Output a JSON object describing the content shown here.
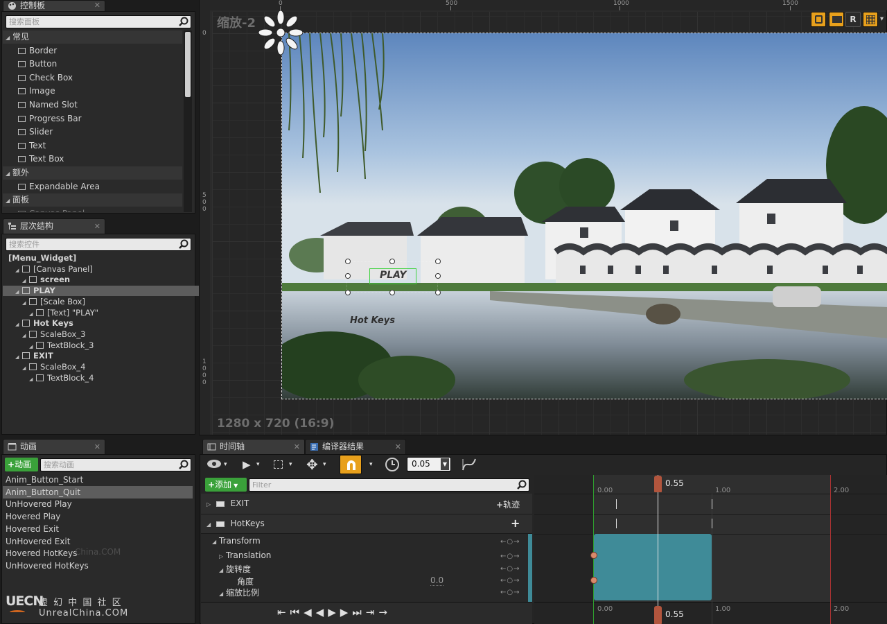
{
  "palette": {
    "title": "控制板",
    "search_placeholder": "搜索面板",
    "categories": [
      {
        "label": "常见"
      },
      {
        "label": "额外"
      },
      {
        "label": "面板"
      }
    ],
    "common_items": [
      "Border",
      "Button",
      "Check Box",
      "Image",
      "Named Slot",
      "Progress Bar",
      "Slider",
      "Text",
      "Text Box"
    ],
    "extra_items": [
      "Expandable Area"
    ],
    "panel_items": [
      "Canvas Panel"
    ]
  },
  "hierarchy": {
    "title": "层次结构",
    "search_placeholder": "搜索控件",
    "items": [
      {
        "label": "[Menu_Widget]",
        "indent": 0,
        "bold": true,
        "eye": false
      },
      {
        "label": "[Canvas Panel]",
        "indent": 1,
        "bold": false,
        "eye": true
      },
      {
        "label": "screen",
        "indent": 2,
        "bold": true,
        "eye": true
      },
      {
        "label": "PLAY",
        "indent": 1,
        "bold": true,
        "eye": true,
        "selected": true
      },
      {
        "label": "[Scale Box]",
        "indent": 2,
        "bold": false,
        "eye": true
      },
      {
        "label": "[Text] \"PLAY\"",
        "indent": 3,
        "bold": false,
        "eye": true
      },
      {
        "label": "Hot Keys",
        "indent": 1,
        "bold": true,
        "eye": true
      },
      {
        "label": "ScaleBox_3",
        "indent": 2,
        "bold": false,
        "eye": true
      },
      {
        "label": "TextBlock_3",
        "indent": 3,
        "bold": false,
        "eye": true
      },
      {
        "label": "EXIT",
        "indent": 1,
        "bold": true,
        "eye": true
      },
      {
        "label": "ScaleBox_4",
        "indent": 2,
        "bold": false,
        "eye": true
      },
      {
        "label": "TextBlock_4",
        "indent": 3,
        "bold": false,
        "eye": true
      }
    ]
  },
  "viewport": {
    "zoom_label": "缩放-2",
    "resolution": "1280 x 720 (16:9)",
    "ruler_top": [
      "0",
      "500",
      "1000",
      "1500"
    ],
    "ruler_left_500": [
      "5",
      "0",
      "0"
    ],
    "ruler_left_1000": [
      "1",
      "0",
      "0",
      "0"
    ],
    "ruler_left_0": "0",
    "canvas_play": "PLAY",
    "canvas_hotkeys": "Hot Keys",
    "right_btn_r": "R"
  },
  "animations": {
    "title": "动画",
    "add_label": "动画",
    "search_placeholder": "搜索动画",
    "items": [
      "Anim_Button_Start",
      "Anim_Button_Quit",
      "UnHovered  Play",
      "Hovered  Play",
      "Hovered  Exit",
      "UnHovered  Exit",
      "Hovered  HotKeys",
      "UnHovered HotKeys"
    ],
    "selected_index": 1
  },
  "watermark": {
    "logo": "UECN",
    "cn": "虚 幻 中 国 社 区",
    "en": "UnrealChina.COM",
    "faint": "China.COM"
  },
  "timeline": {
    "tab1": "时间轴",
    "tab2": "编译器结果",
    "step_value": "0.05",
    "add_label": "添加",
    "filter_placeholder": "Filter",
    "track_label": "轨迹",
    "tracks": [
      {
        "label": "EXIT"
      },
      {
        "label": "HotKeys"
      }
    ],
    "transform": "Transform",
    "translation": "Translation",
    "rotation": "旋转度",
    "angle": "角度",
    "angle_value": "0.0",
    "scale": "缩放比例",
    "time_labels": [
      "0.00",
      "1.00",
      "2.00"
    ],
    "playhead": "0.55"
  },
  "colors": {
    "accent_orange": "#e8a01c",
    "key_block": "#3f8b98",
    "add_green": "#3aa13a",
    "playhead_marker": "#b2553d"
  }
}
